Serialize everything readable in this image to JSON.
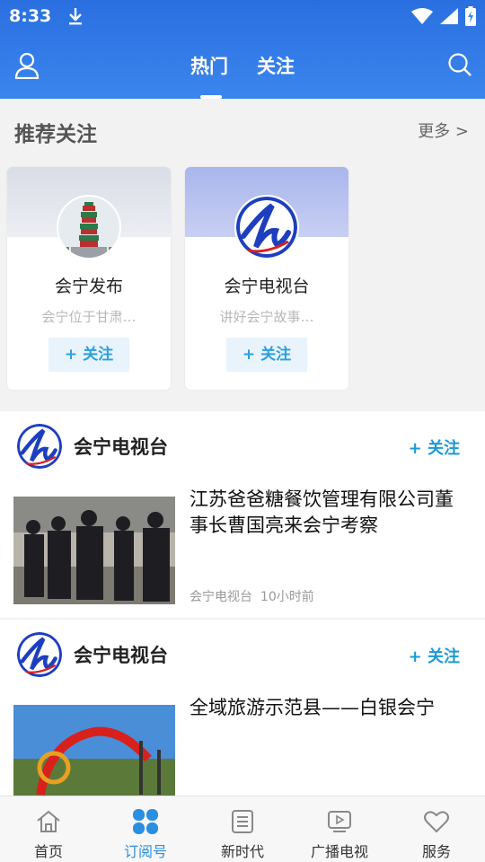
{
  "status": {
    "time": "8:33"
  },
  "header": {
    "tabs": [
      {
        "label": "热门"
      },
      {
        "label": "关注"
      }
    ]
  },
  "recommend": {
    "title": "推荐关注",
    "more": "更多 >",
    "cards": [
      {
        "name": "会宁发布",
        "desc": "会宁位于甘肃…",
        "follow": "+ 关注"
      },
      {
        "name": "会宁电视台",
        "desc": "讲好会宁故事…",
        "follow": "+ 关注"
      }
    ]
  },
  "feed": [
    {
      "source": "会宁电视台",
      "follow": "+ 关注",
      "title": "江苏爸爸糖餐饮管理有限公司董事长曹国亮来会宁考察",
      "meta_source": "会宁电视台",
      "meta_time": "10小时前"
    },
    {
      "source": "会宁电视台",
      "follow": "+ 关注",
      "title": "全域旅游示范县——白银会宁"
    }
  ],
  "bottom_nav": [
    {
      "label": "首页",
      "icon": "home-icon"
    },
    {
      "label": "订阅号",
      "icon": "subscribe-icon",
      "active": true
    },
    {
      "label": "新时代",
      "icon": "document-icon"
    },
    {
      "label": "广播电视",
      "icon": "tv-icon"
    },
    {
      "label": "服务",
      "icon": "heart-icon"
    }
  ],
  "colors": {
    "header": "#3b86ee",
    "accent": "#1a9ad6",
    "active_nav": "#2a8fe0"
  }
}
